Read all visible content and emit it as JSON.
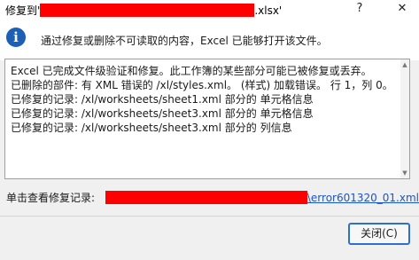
{
  "window": {
    "title_prefix": "修复到'",
    "title_suffix": ".xlsx'",
    "help_button": "?",
    "close_button": "✕"
  },
  "icons": {
    "info": "info-icon"
  },
  "message": "通过修复或删除不可读取的内容，Excel 已能够打开该文件。",
  "details": [
    "Excel 已完成文件级验证和修复。此工作簿的某些部分可能已被修复或丢弃。",
    "已删除的部件: 有 XML 错误的 /xl/styles.xml。 (样式) 加载错误。 行 1，列 0。",
    "已修复的记录: /xl/worksheets/sheet1.xml 部分的 单元格信息",
    "已修复的记录: /xl/worksheets/sheet3.xml 部分的 单元格信息",
    "已修复的记录: /xl/worksheets/sheet3.xml 部分的 列信息"
  ],
  "repair_log": {
    "label": "单击查看修复记录:",
    "link_suffix": "\\error601320_01.xml"
  },
  "buttons": {
    "close": "关闭(C)"
  },
  "colors": {
    "redaction": "#ff0000",
    "accent": "#2f6fd0",
    "link": "#1a55c7"
  }
}
